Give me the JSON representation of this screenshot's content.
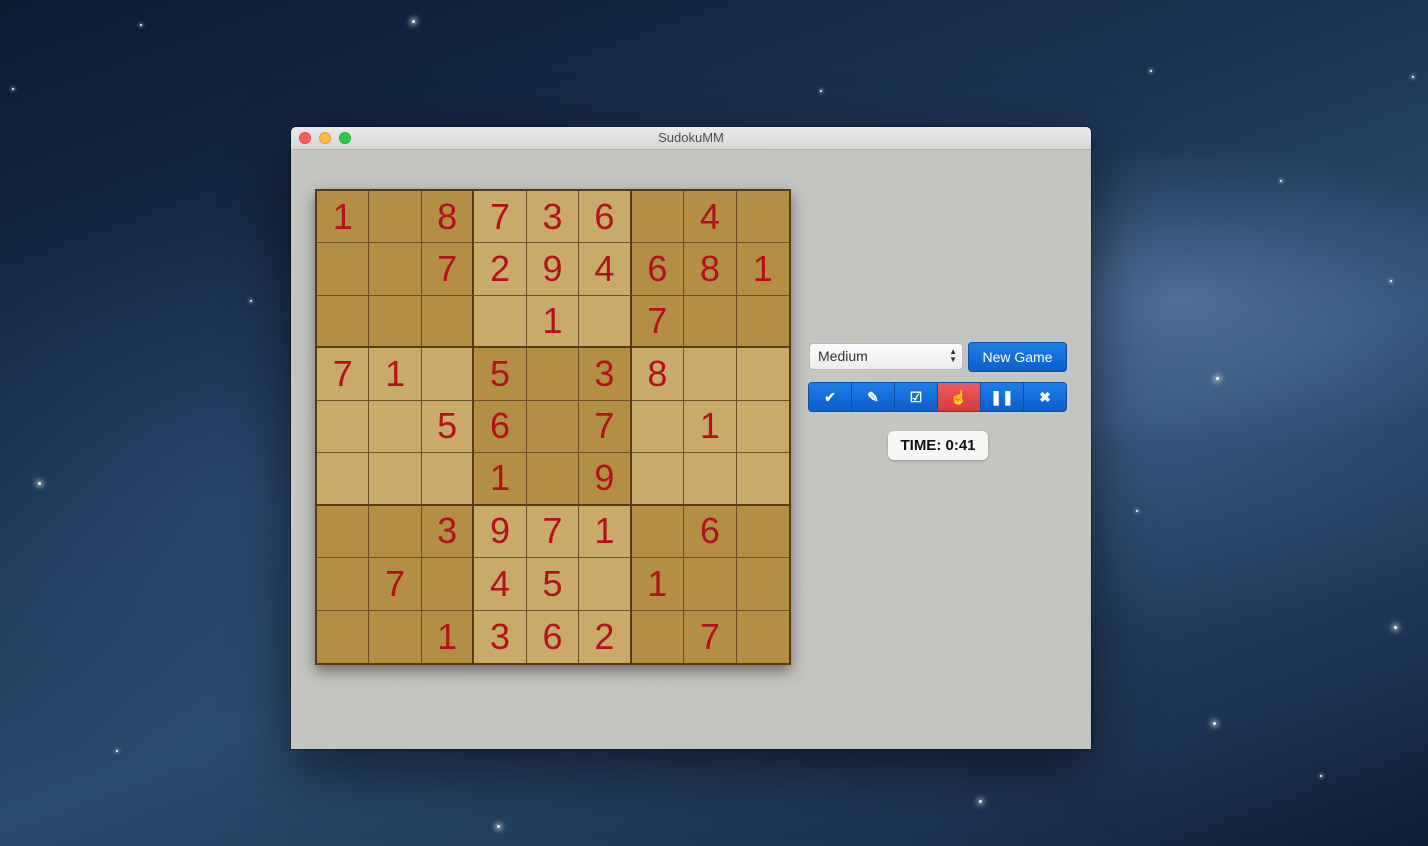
{
  "window": {
    "title": "SudokuMM"
  },
  "controls": {
    "difficulty": "Medium",
    "new_game_label": "New Game",
    "tools": [
      {
        "name": "check-icon",
        "glyph": "✔"
      },
      {
        "name": "pencil-icon",
        "glyph": "✎"
      },
      {
        "name": "edit-note-icon",
        "glyph": "☑"
      },
      {
        "name": "hand-pointer-icon",
        "glyph": "☝"
      },
      {
        "name": "pause-icon",
        "glyph": "❚❚"
      },
      {
        "name": "close-icon",
        "glyph": "✖"
      }
    ],
    "active_tool": 3,
    "timer": "TIME: 0:41"
  },
  "board": [
    [
      "1",
      "",
      "8",
      "7",
      "3",
      "6",
      "",
      "4",
      ""
    ],
    [
      "",
      "",
      "7",
      "2",
      "9",
      "4",
      "6",
      "8",
      "1"
    ],
    [
      "",
      "",
      "",
      "",
      "1",
      "",
      "7",
      "",
      ""
    ],
    [
      "7",
      "1",
      "",
      "5",
      "",
      "3",
      "8",
      "",
      ""
    ],
    [
      "",
      "",
      "5",
      "6",
      "",
      "7",
      "",
      "1",
      ""
    ],
    [
      "",
      "",
      "",
      "1",
      "",
      "9",
      "",
      "",
      ""
    ],
    [
      "",
      "",
      "3",
      "9",
      "7",
      "1",
      "",
      "6",
      ""
    ],
    [
      "",
      "7",
      "",
      "4",
      "5",
      "",
      "1",
      "",
      ""
    ],
    [
      "",
      "",
      "1",
      "3",
      "6",
      "2",
      "",
      "7",
      ""
    ]
  ],
  "colors": {
    "digit": "#b3121c",
    "box_dark": "#b38e45",
    "box_light": "#c8aa6b",
    "accent": "#0b5ec9",
    "active_tool": "#d63b3b"
  }
}
